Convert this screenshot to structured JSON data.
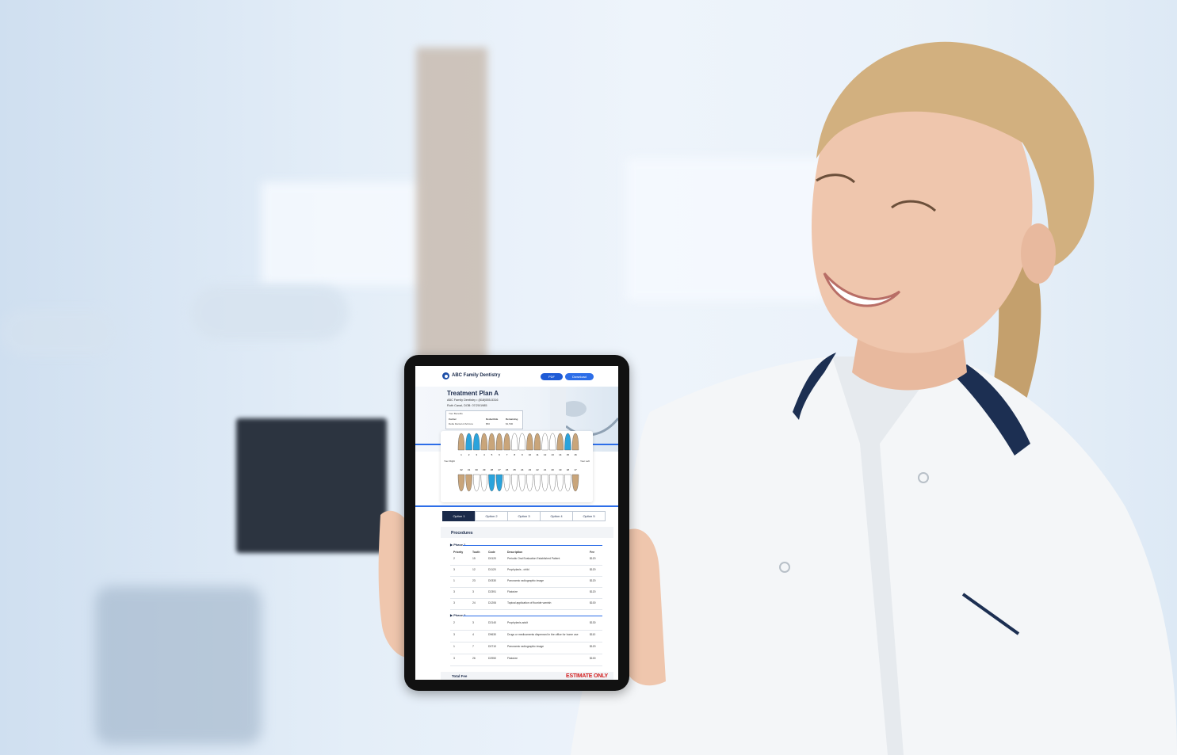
{
  "app": {
    "title": "ABC Family Dentistry",
    "pdf_label": "PDF",
    "download_label": "Download"
  },
  "plan": {
    "title": "Treatment Plan A",
    "practice_line": "ABC Family Dentistry • (818)555-5316",
    "patient_line": "Ruth Canal, DOB: 07/20/1985",
    "benefits": {
      "heading": "Your Benefits",
      "col_carrier": "Carrier",
      "col_deductible": "Deductible",
      "col_remaining": "Remaining",
      "carrier": "Delta Dental of Arizona",
      "deductible": "$50",
      "remaining": "$1,500"
    }
  },
  "chart": {
    "upper_right_label": "Your Right",
    "upper_left_label": "Your Left",
    "upper_numbers": [
      "1",
      "2",
      "3",
      "4",
      "5",
      "6",
      "7",
      "8",
      "9",
      "10",
      "11",
      "12",
      "13",
      "14",
      "15",
      "16"
    ],
    "lower_numbers": [
      "32",
      "31",
      "30",
      "29",
      "28",
      "27",
      "26",
      "25",
      "24",
      "23",
      "22",
      "21",
      "20",
      "19",
      "18",
      "17"
    ]
  },
  "tabs": [
    {
      "label": "Option 1",
      "active": true
    },
    {
      "label": "Option 2",
      "active": false
    },
    {
      "label": "Option 3",
      "active": false
    },
    {
      "label": "Option 4",
      "active": false
    },
    {
      "label": "Option 5",
      "active": false
    }
  ],
  "procedures": {
    "title": "Procedures",
    "headers": {
      "priority": "Priority",
      "tooth": "Tooth",
      "code": "Code",
      "description": "Description",
      "fee": "Fee"
    },
    "phase1": {
      "label": "Phase 1",
      "rows": [
        {
          "priority": "2",
          "tooth": "15",
          "code": "D0120",
          "description": "Periodic Oral Evaluation Established Patient",
          "fee": "$120"
        },
        {
          "priority": "3",
          "tooth": "12",
          "code": "D1120",
          "description": "Prophylaxis - child",
          "fee": "$120"
        },
        {
          "priority": "1",
          "tooth": "23",
          "code": "D0330",
          "description": "Panoramic radiographic image",
          "fee": "$120"
        },
        {
          "priority": "3",
          "tooth": "3",
          "code": "D2391",
          "description": "Flatorize",
          "fee": "$120"
        },
        {
          "priority": "3",
          "tooth": "24",
          "code": "D1206",
          "description": "Topical application of fluoride varnish",
          "fee": "$100"
        }
      ]
    },
    "phase2": {
      "label": "Phase 2",
      "rows": [
        {
          "priority": "2",
          "tooth": "3",
          "code": "D2140",
          "description": "Prophylaxis-adult",
          "fee": "$130"
        },
        {
          "priority": "3",
          "tooth": "4",
          "code": "D9630",
          "description": "Drugs or medicaments dispensed in the office for home use",
          "fee": "$110"
        },
        {
          "priority": "1",
          "tooth": "7",
          "code": "D0710",
          "description": "Panoramic radiographic image",
          "fee": "$120"
        },
        {
          "priority": "3",
          "tooth": "26",
          "code": "D2950",
          "description": "Flatorize",
          "fee": "$100"
        }
      ]
    }
  },
  "footer": {
    "total_label": "Total Fee",
    "estimate_stamp": "ESTIMATE ONLY"
  },
  "colors": {
    "accent": "#2d6ee8",
    "navy": "#1a2a4a",
    "tooth_blue": "#2aa3dc",
    "tooth_tan": "#c9a57a",
    "stamp_red": "#d32020"
  }
}
